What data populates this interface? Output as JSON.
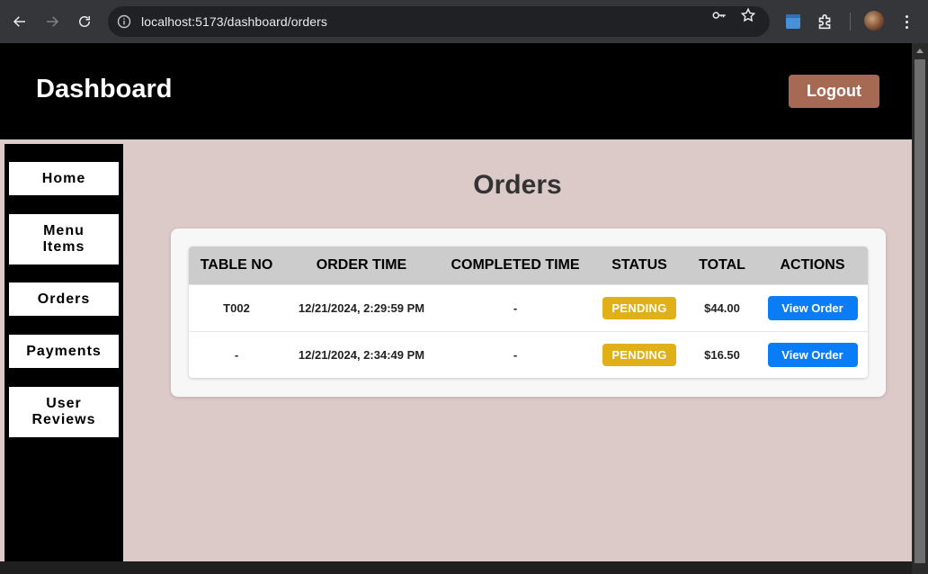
{
  "browser": {
    "url": "localhost:5173/dashboard/orders",
    "icons": [
      "back-icon",
      "forward-icon",
      "reload-icon",
      "site-info-icon",
      "password-key-icon",
      "bookmark-star-icon",
      "extension-icon",
      "puzzle-icon",
      "profile-avatar",
      "more-icon"
    ]
  },
  "header": {
    "title": "Dashboard",
    "logout_label": "Logout"
  },
  "sidebar": {
    "items": [
      {
        "label": "Home"
      },
      {
        "label": "Menu\nItems"
      },
      {
        "label": "Orders"
      },
      {
        "label": "Payments"
      },
      {
        "label": "User\nReviews"
      }
    ]
  },
  "main": {
    "title": "Orders",
    "table": {
      "headers": [
        "TABLE NO",
        "ORDER TIME",
        "COMPLETED TIME",
        "STATUS",
        "TOTAL",
        "ACTIONS"
      ],
      "rows": [
        {
          "table_no": "T002",
          "order_time": "12/21/2024, 2:29:59 PM",
          "completed_time": "-",
          "status": "PENDING",
          "total": "$44.00",
          "action": "View Order"
        },
        {
          "table_no": "-",
          "order_time": "12/21/2024, 2:34:49 PM",
          "completed_time": "-",
          "status": "PENDING",
          "total": "$16.50",
          "action": "View Order"
        }
      ]
    }
  },
  "colors": {
    "header_bg": "#000000",
    "logout_bg": "#a66a54",
    "main_bg": "#dbcac7",
    "status_pending": "#e0b018",
    "view_button": "#0a7cf5",
    "table_header": "#cccccc"
  }
}
